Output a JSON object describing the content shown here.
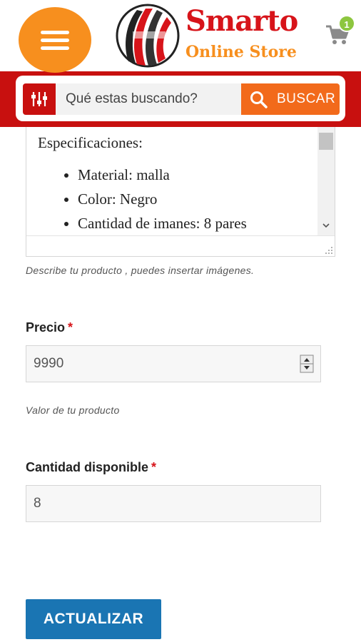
{
  "header": {
    "menu_icon": "hamburger-icon",
    "brand_name": "Smarto",
    "brand_tagline": "Online Store",
    "cart_icon": "cart-icon",
    "cart_count": "1"
  },
  "search": {
    "filter_icon": "sliders-icon",
    "placeholder": "Qué estas buscando?",
    "button_icon": "search-icon",
    "button_label": "BUSCAR"
  },
  "description": {
    "heading": "Especificaciones:",
    "items": [
      "Material: malla",
      "Color: Negro",
      "Cantidad de imanes: 8 pares"
    ],
    "hint": "Describe tu producto , puedes insertar imágenes."
  },
  "price": {
    "label": "Precio",
    "required_mark": "*",
    "value": "9990",
    "hint": "Valor de tu producto"
  },
  "quantity": {
    "label": "Cantidad disponible",
    "required_mark": "*",
    "value": "8"
  },
  "actions": {
    "update_label": "ACTUALIZAR"
  },
  "colors": {
    "brand_red": "#c8100f",
    "brand_orange": "#f78f1e",
    "search_orange": "#f26a1b",
    "badge_green": "#8dc63f",
    "button_blue": "#1a75b3"
  }
}
